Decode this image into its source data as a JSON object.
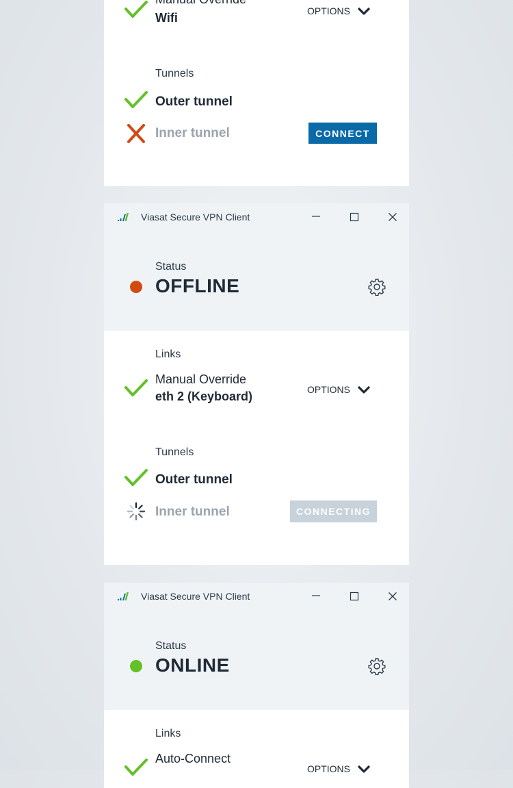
{
  "colors": {
    "accent": "#0a6aa8",
    "online": "#64c027",
    "offline": "#d24a12",
    "check": "#64c027",
    "error": "#d24a12",
    "disabled_button": "#c7d2db",
    "status_band": "#eff3f6"
  },
  "panel1": {
    "link_name": "Manual Override",
    "link_interface": "Wifi",
    "options_label": "OPTIONS",
    "tunnels_label": "Tunnels",
    "outer_tunnel": "Outer tunnel",
    "inner_tunnel": "Inner tunnel",
    "connect_label": "CONNECT",
    "icons": [
      "check-icon",
      "chevron-down-icon",
      "check-icon",
      "x-icon"
    ]
  },
  "panel2": {
    "app_title": "Viasat Secure VPN Client",
    "status_label": "Status",
    "status_value": "OFFLINE",
    "links_label": "Links",
    "link_name": "Manual Override",
    "link_interface": "eth 2 (Keyboard)",
    "options_label": "OPTIONS",
    "tunnels_label": "Tunnels",
    "outer_tunnel": "Outer tunnel",
    "inner_tunnel": "Inner tunnel",
    "connecting_label": "CONNECTING",
    "icons": [
      "viasat-logo-icon",
      "minimize-icon",
      "maximize-icon",
      "close-icon",
      "gear-icon",
      "check-icon",
      "spinner-icon"
    ]
  },
  "panel3": {
    "app_title": "Viasat Secure VPN Client",
    "status_label": "Status",
    "status_value": "ONLINE",
    "links_label": "Links",
    "link_name": "Auto-Connect",
    "options_label": "OPTIONS",
    "icons": [
      "viasat-logo-icon",
      "minimize-icon",
      "maximize-icon",
      "close-icon",
      "gear-icon",
      "check-icon",
      "chevron-down-icon"
    ]
  }
}
